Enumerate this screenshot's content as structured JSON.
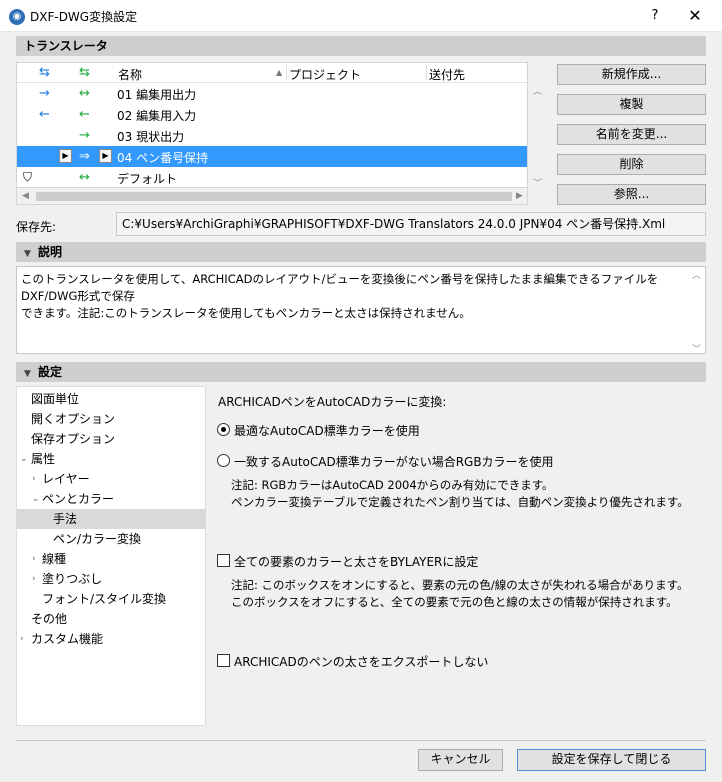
{
  "window": {
    "title": "DXF-DWG変換設定",
    "help": "?",
    "close": "✕"
  },
  "sections": {
    "translator": "トランスレータ",
    "description": "説明",
    "settings": "設定"
  },
  "list": {
    "columns": {
      "name": "名称",
      "project": "プロジェクト",
      "dest": "送付先"
    },
    "rows": [
      {
        "a1": "→",
        "a2": "↔",
        "label": "01 編集用出力"
      },
      {
        "a1": "←",
        "a2": "←",
        "label": "02 編集用入力"
      },
      {
        "a1": "",
        "a2": "→",
        "label": "03 現状出力"
      },
      {
        "a1": "",
        "a2": "⇒",
        "label": "04 ペン番号保持"
      },
      {
        "a1": "⛉",
        "a2": "↔",
        "label": "デフォルト"
      }
    ]
  },
  "buttons": {
    "new": "新規作成...",
    "duplicate": "複製",
    "rename": "名前を変更...",
    "delete": "削除",
    "browse": "参照...",
    "cancel": "キャンセル",
    "save_close": "設定を保存して閉じる"
  },
  "save_path": {
    "label": "保存先:",
    "value": "C:¥Users¥ArchiGraphi¥GRAPHISOFT¥DXF-DWG Translators 24.0.0 JPN¥04 ペン番号保持.Xml"
  },
  "description": {
    "line1": "このトランスレータを使用して、ARCHICADのレイアウト/ビューを変換後にペン番号を保持したまま編集できるファイルをDXF/DWG形式で保存",
    "line2": "できます。注記:このトランスレータを使用してもペンカラーと太さは保持されません。"
  },
  "tree": {
    "items": [
      "図面単位",
      "開くオプション",
      "保存オプション",
      "属性",
      "レイヤー",
      "ペンとカラー",
      "手法",
      "ペン/カラー変換",
      "線種",
      "塗りつぶし",
      "フォント/スタイル変換",
      "その他",
      "カスタム機能"
    ]
  },
  "panel": {
    "heading": "ARCHICADペンをAutoCADカラーに変換:",
    "radio1": "最適なAutoCAD標準カラーを使用",
    "radio2": "一致するAutoCAD標準カラーがない場合RGBカラーを使用",
    "note1_line1": "注記: RGBカラーはAutoCAD 2004からのみ有効にできます。",
    "note1_line2": "ペンカラー変換テーブルで定義されたペン割り当ては、自動ペン変換より優先されます。",
    "check1": "全ての要素のカラーと太さをBYLAYERに設定",
    "note2_line1": "注記: このボックスをオンにすると、要素の元の色/線の太さが失われる場合があります。",
    "note2_line2": "このボックスをオフにすると、全ての要素で元の色と線の太さの情報が保持されます。",
    "check2": "ARCHICADのペンの太さをエクスポートしない"
  }
}
